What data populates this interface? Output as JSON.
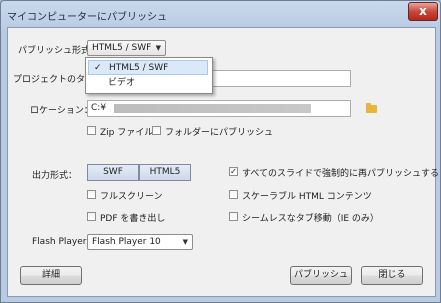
{
  "window": {
    "title": "マイコンピューターにパブリッシュ",
    "close_glyph": "x"
  },
  "publish_format": {
    "label": "パブリッシュ形式：",
    "value": "HTML5 / SWF",
    "options": [
      "HTML5 / SWF",
      "ビデオ"
    ],
    "check": "✓"
  },
  "project": {
    "label": "プロジェクトのタイ...",
    "value": ""
  },
  "location": {
    "label": "ロケーション：",
    "value": "C:¥"
  },
  "zip": {
    "label": "Zip ファイル",
    "checked": false
  },
  "folder_publish": {
    "label": "フォルダーにパブリッシュ",
    "checked": false
  },
  "output": {
    "label": "出力形式：",
    "swf": "SWF",
    "html5": "HTML5"
  },
  "fullscreen": {
    "label": "フルスクリーン",
    "checked": false
  },
  "pdf": {
    "label": "PDF を書き出し",
    "checked": false
  },
  "force_republish": {
    "label": "すべてのスライドで強制的に再パブリッシュする",
    "checked": true,
    "mark": "✓"
  },
  "scalable": {
    "label": "スケーラブル HTML コンテンツ",
    "checked": false
  },
  "seamless": {
    "label": "シームレスなタブ移動（IE のみ）",
    "checked": false
  },
  "flash_player": {
    "label": "Flash Player:",
    "value": "Flash Player 10"
  },
  "buttons": {
    "details": "詳細",
    "publish": "パブリッシュ",
    "close": "閉じる"
  },
  "icons": {
    "folder": "folder-icon",
    "dropdown": "chevron-down-icon"
  }
}
